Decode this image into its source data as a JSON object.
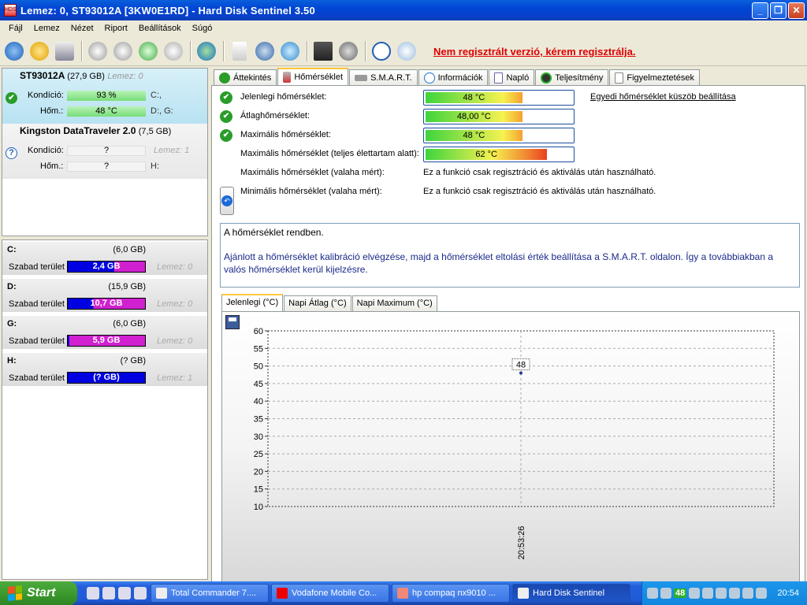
{
  "window": {
    "title": "Lemez: 0, ST93012A [3KW0E1RD]  -  Hard Disk Sentinel 3.50",
    "app_icon_text": "HDS",
    "minimize": "_",
    "maximize": "❐",
    "close": "✕"
  },
  "menu": [
    "Fájl",
    "Lemez",
    "Nézet",
    "Riport",
    "Beállítások",
    "Súgó"
  ],
  "toolbar": {
    "register_link": "Nem regisztrált verzió, kérem regisztrálja."
  },
  "disks": [
    {
      "name": "ST93012A",
      "size": "(27,9 GB)",
      "lemez": "Lemez: 0",
      "health_label": "Kondíció:",
      "health_value": "93 %",
      "health_percent": 93,
      "temp_label": "Hőm.:",
      "temp_value": "48 °C",
      "drives_line1": "C:,",
      "drives_line2": "D:, G:"
    },
    {
      "name": "Kingston DataTraveler 2.0",
      "size": "(7,5 GB)",
      "lemez": "Lemez: 1",
      "health_label": "Kondíció:",
      "health_value": "?",
      "temp_label": "Hőm.:",
      "temp_value": "?",
      "drives_line1": "H:"
    }
  ],
  "partitions": [
    {
      "letter": "C:",
      "capacity": "(6,0 GB)",
      "free_label": "Szabad terület",
      "free_value": "2,4 GB",
      "lemez": "Lemez: 0",
      "bar_style": "blue-mag"
    },
    {
      "letter": "D:",
      "capacity": "(15,9 GB)",
      "free_label": "Szabad terület",
      "free_value": "10,7 GB",
      "lemez": "Lemez: 0",
      "bar_style": "mag-blue"
    },
    {
      "letter": "G:",
      "capacity": "(6,0 GB)",
      "free_label": "Szabad terület",
      "free_value": "5,9 GB",
      "lemez": "Lemez: 0",
      "bar_style": "mag"
    },
    {
      "letter": "H:",
      "capacity": "(? GB)",
      "free_label": "Szabad terület",
      "free_value": "(? GB)",
      "lemez": "Lemez: 1",
      "bar_style": "blue"
    }
  ],
  "tabs": [
    "Áttekintés",
    "Hőmérséklet",
    "S.M.A.R.T.",
    "Információk",
    "Napló",
    "Teljesítmény",
    "Figyelmeztetések"
  ],
  "active_tab": "Hőmérséklet",
  "temperature": {
    "current_label": "Jelenlegi hőmérséklet:",
    "current_value": "48 °C",
    "avg_label": "Átlaghőmérséklet:",
    "avg_value": "48,00 °C",
    "max_label": "Maximális hőmérséklet:",
    "max_value": "48 °C",
    "max_life_label": "Maximális hőmérséklet (teljes élettartam alatt):",
    "max_life_value": "62 °C",
    "max_ever_label": "Maximális hőmérséklet (valaha mért):",
    "min_ever_label": "Minimális hőmérséklet (valaha mért):",
    "not_available": "Ez a funkció csak regisztráció és aktiválás után használható.",
    "custom_threshold_link": "Egyedi hőmérséklet küszöb beállítása",
    "status_message": "A hőmérséklet rendben.",
    "advice": "Ajánlott a hőmérséklet kalibráció elvégzése, majd a hőmérséklet eltolási érték beállítása a S.M.A.R.T. oldalon. Így a továbbiakban a valós hőmérséklet kerül kijelzésre."
  },
  "chart_tabs": [
    "Jelenlegi (°C)",
    "Napi Átlag (°C)",
    "Napi Maximum (°C)"
  ],
  "chart_data": {
    "type": "scatter",
    "x": [
      "20:53:26"
    ],
    "y": [
      48
    ],
    "data_labels": [
      "48"
    ],
    "ylim": [
      10,
      60
    ],
    "yticks": [
      10,
      15,
      20,
      25,
      30,
      35,
      40,
      45,
      50,
      55,
      60
    ],
    "grid": true,
    "color": "#1a3aa0"
  },
  "taskbar": {
    "start": "Start",
    "tasks": [
      "Total Commander 7....",
      "Vodafone Mobile Co...",
      "hp compaq nx9010 ...",
      "Hard Disk Sentinel"
    ],
    "tray_temp": "48",
    "clock": "20:54"
  }
}
